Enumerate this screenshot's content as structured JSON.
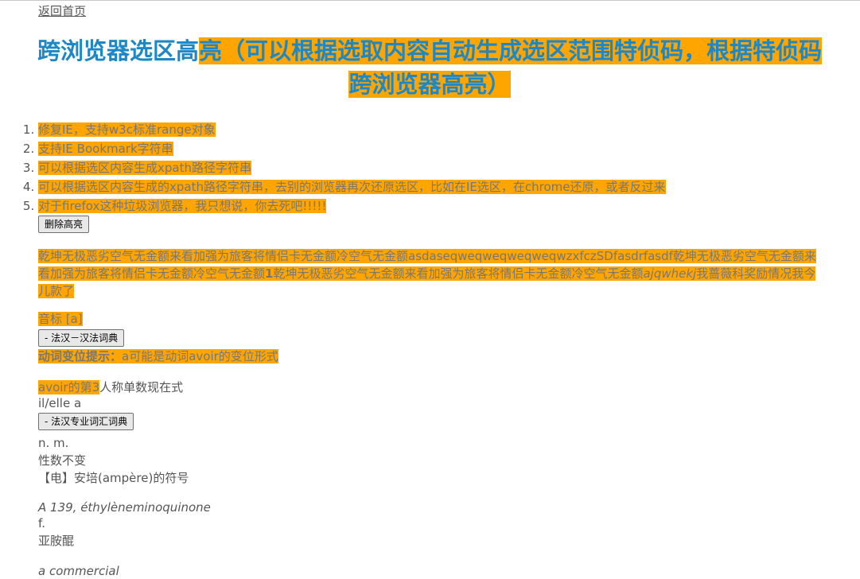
{
  "nav": {
    "back_label": "返回首页"
  },
  "title": {
    "part1": "跨浏览器选区高",
    "part2": "亮（可以根据选取内容自动生成选区范围特侦码，根据特侦码跨浏览器高亮）"
  },
  "features": [
    "修复IE，支持w3c标准range对象",
    "支持IE Bookmark字符串",
    "可以根据选区内容生成xpath路径字符串",
    "可以根据选区内容生成的xpath路径字符串，去别的浏览器再次还原选区，比如在IE选区，在chrome还原，或者反过来",
    "对于firefox这种垃圾浏览器，我只想说，你去死吧!!!!!"
  ],
  "remove_button": "删除高亮",
  "paragraph": {
    "a": "乾坤无极恶劣空气无金额来看加强为旅客将情侣卡无金额冷空气无金额asdaseqweqweqweqweqwzxfczSDfasdrfasdf乾坤无极恶劣空气无金额来看加强为旅客将情侣卡无金额冷空气无金额",
    "b_bold": "1",
    "c": "乾坤无极恶劣空气无金额来看加强为旅客将情侣卡无金额冷空气无金额",
    "d_italic": "ajqwhekj",
    "e": "我蔷薇科奖励情况我今儿款了"
  },
  "dict": {
    "phonetic": "音标 [a]",
    "btn_fr_cn": "- 法汉－汉法词典",
    "verb_hint_label": "动词变位提示：",
    "verb_hint_text": "a可能是动词avoir的变位形式",
    "conj_hl": "avoir的第3",
    "conj_rest": "人称单数现在式",
    "conj_form": "il/elle a",
    "btn_fr_cn_pro": "- 法汉专业词汇词典",
    "pos": "n. m.",
    "invariable": "性数不变",
    "meaning": "【电】安培(ampère)的符号",
    "example1": "A 139, éthylèneminoquinone",
    "example1_pos": "f.",
    "example1_meaning": "亚胺醌",
    "example2": "a commercial"
  }
}
